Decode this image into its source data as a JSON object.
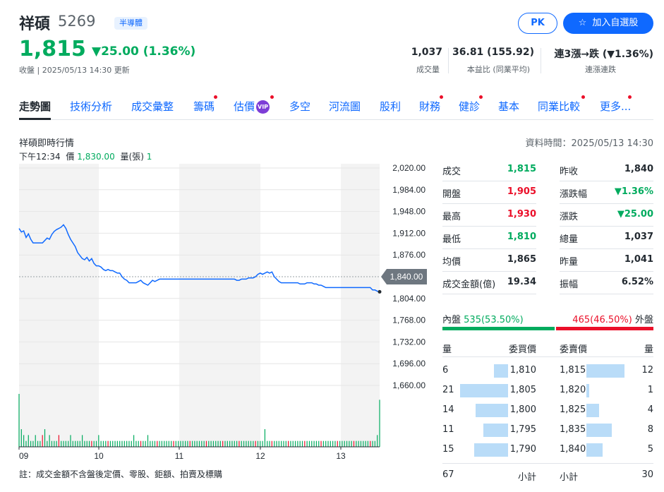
{
  "header": {
    "name": "祥碩",
    "code": "5269",
    "industry": "半導體",
    "pk_label": "PK",
    "watchlist_label": "加入自選股",
    "price": "1,815",
    "change": "▼25.00 (1.36%)",
    "close_time": "收盤 | 2025/05/13 14:30 更新",
    "stats": [
      {
        "value": "1,037",
        "label": "成交量"
      },
      {
        "value": "36.81 (155.92)",
        "label": "本益比 (同業平均)"
      },
      {
        "value": "連3漲→跌 (▼1.36%)",
        "label": "連漲連跌"
      }
    ]
  },
  "tabs": [
    {
      "label": "走勢圖",
      "active": true,
      "dot": false
    },
    {
      "label": "技術分析",
      "dot": false
    },
    {
      "label": "成交彙整",
      "dot": false
    },
    {
      "label": "籌碼",
      "dot": true
    },
    {
      "label": "估價",
      "dot": true,
      "vip": "VIP"
    },
    {
      "label": "多空",
      "dot": false
    },
    {
      "label": "河流圖",
      "dot": false
    },
    {
      "label": "股利",
      "dot": false
    },
    {
      "label": "財務",
      "dot": true
    },
    {
      "label": "健診",
      "dot": true
    },
    {
      "label": "基本",
      "dot": false
    },
    {
      "label": "同業比較",
      "dot": true
    },
    {
      "label": "更多...",
      "dot": true
    }
  ],
  "chart_section": {
    "title": "祥碩即時行情",
    "data_time": "資料時間：2025/05/13 14:30",
    "tooltip": {
      "time": "下午12:34",
      "price_label": "價",
      "price": "1,830.00",
      "vol_label": "量(張)",
      "vol": "1"
    },
    "current_tag": "1,840.00",
    "footnote": "註：成交金額不含盤後定價、零股、鉅額、拍賣及標購"
  },
  "chart_data": {
    "type": "line",
    "y_ticks": [
      "2,020.00",
      "1,984.00",
      "1,948.00",
      "1,912.00",
      "1,876.00",
      "1,840.00",
      "1,804.00",
      "1,768.00",
      "1,732.00",
      "1,696.00",
      "1,660.00"
    ],
    "x_ticks": [
      "09",
      "10",
      "11",
      "12",
      "13"
    ],
    "ylim": [
      1660,
      2020
    ],
    "reference_price": 1840,
    "series": [
      {
        "values": [
          1920,
          1914,
          1916,
          1905,
          1911,
          1902,
          1896,
          1896,
          1896,
          1896,
          1896,
          1900,
          1904,
          1902,
          1910,
          1915,
          1918,
          1920,
          1922,
          1926,
          1920,
          1910,
          1902,
          1896,
          1890,
          1880,
          1875,
          1870,
          1868,
          1872,
          1866,
          1870,
          1862,
          1858,
          1858,
          1856,
          1852,
          1850,
          1852,
          1850,
          1850,
          1848,
          1846,
          1846,
          1840,
          1836,
          1834,
          1830,
          1830,
          1830,
          1830,
          1832,
          1834,
          1830,
          1828,
          1826,
          1830,
          1834,
          1832,
          1834,
          1836,
          1836,
          1836,
          1836,
          1836,
          1836,
          1836,
          1836,
          1836,
          1836,
          1836,
          1836,
          1836,
          1836,
          1836,
          1836,
          1836,
          1836,
          1836,
          1836,
          1836,
          1836,
          1836,
          1836,
          1836,
          1836,
          1836,
          1836,
          1836,
          1836,
          1836,
          1836,
          1836,
          1834,
          1834,
          1836,
          1836,
          1836,
          1838,
          1838,
          1838,
          1840,
          1844,
          1846,
          1844,
          1846,
          1848,
          1846,
          1848,
          1840,
          1836,
          1832,
          1830,
          1830,
          1830,
          1830,
          1830,
          1830,
          1830,
          1830,
          1828,
          1828,
          1828,
          1830,
          1830,
          1830,
          1828,
          1828,
          1826,
          1826,
          1824,
          1822,
          1822,
          1822,
          1822,
          1822,
          1822,
          1822,
          1822,
          1822,
          1822,
          1822,
          1822,
          1822,
          1822,
          1822,
          1822,
          1822,
          1822,
          1822,
          1822,
          1818,
          1818,
          1816,
          1815
        ]
      }
    ],
    "volume": [
      9,
      3,
      2,
      1,
      2,
      1,
      1,
      2,
      1,
      1,
      2,
      3,
      1,
      2,
      1,
      1,
      1,
      2,
      1,
      1,
      1,
      1,
      2,
      1,
      1,
      1,
      1,
      2,
      1,
      1,
      1,
      1,
      1,
      1,
      2,
      1,
      1,
      1,
      1,
      1,
      1,
      1,
      1,
      1,
      1,
      1,
      1,
      1,
      1,
      2,
      1,
      1,
      1,
      1,
      1,
      2,
      1,
      1,
      1,
      1,
      1,
      1,
      1,
      1,
      1,
      1,
      1,
      1,
      1,
      1,
      1,
      1,
      1,
      1,
      1,
      1,
      1,
      1,
      1,
      1,
      1,
      1,
      1,
      1,
      1,
      1,
      1,
      1,
      1,
      1,
      1,
      1,
      1,
      1,
      1,
      1,
      1,
      1,
      1,
      1,
      1,
      1,
      1,
      1,
      1,
      3,
      1,
      1,
      1,
      1,
      1,
      1,
      1,
      1,
      1,
      1,
      1,
      1,
      1,
      1,
      1,
      1,
      1,
      1,
      1,
      1,
      1,
      1,
      1,
      1,
      1,
      1,
      1,
      1,
      1,
      1,
      1,
      1,
      1,
      1,
      1,
      1,
      1,
      1,
      1,
      1,
      1,
      1,
      1,
      1,
      1,
      1,
      1,
      2,
      8
    ]
  },
  "quote": {
    "left": [
      {
        "label": "成交",
        "value": "1,815",
        "color": "green"
      },
      {
        "label": "開盤",
        "value": "1,905",
        "color": "red"
      },
      {
        "label": "最高",
        "value": "1,930",
        "color": "red"
      },
      {
        "label": "最低",
        "value": "1,810",
        "color": "green"
      },
      {
        "label": "均價",
        "value": "1,865",
        "color": "dark"
      },
      {
        "label": "成交金額(億)",
        "value": "19.34",
        "color": "dark"
      }
    ],
    "right": [
      {
        "label": "昨收",
        "value": "1,840",
        "color": "dark"
      },
      {
        "label": "漲跌幅",
        "value": "▼1.36%",
        "color": "green"
      },
      {
        "label": "漲跌",
        "value": "▼25.00",
        "color": "green"
      },
      {
        "label": "總量",
        "value": "1,037",
        "color": "dark"
      },
      {
        "label": "昨量",
        "value": "1,041",
        "color": "dark"
      },
      {
        "label": "振幅",
        "value": "6.52%",
        "color": "dark"
      }
    ]
  },
  "orderbook": {
    "inner_label": "內盤",
    "inner_value": "535",
    "inner_pct": "(53.50%)",
    "outer_value": "465",
    "outer_pct": "(46.50%)",
    "outer_label": "外盤",
    "inner_ratio": 0.535,
    "head": {
      "qty": "量",
      "bid": "委買價",
      "ask": "委賣價",
      "qty2": "量"
    },
    "bids": [
      {
        "qty": "6",
        "price": "1,810",
        "ratio": 0.29
      },
      {
        "qty": "21",
        "price": "1,805",
        "ratio": 1.0
      },
      {
        "qty": "14",
        "price": "1,800",
        "ratio": 0.67
      },
      {
        "qty": "11",
        "price": "1,795",
        "ratio": 0.52
      },
      {
        "qty": "15",
        "price": "1,790",
        "ratio": 0.71
      }
    ],
    "asks": [
      {
        "price": "1,815",
        "qty": "12",
        "ratio": 1.0
      },
      {
        "price": "1,820",
        "qty": "1",
        "ratio": 0.08
      },
      {
        "price": "1,825",
        "qty": "4",
        "ratio": 0.33
      },
      {
        "price": "1,835",
        "qty": "8",
        "ratio": 0.67
      },
      {
        "price": "1,840",
        "qty": "5",
        "ratio": 0.42
      }
    ],
    "bid_total": "67",
    "bid_total_label": "小計",
    "ask_total_label": "小計",
    "ask_total": "30"
  },
  "colors": {
    "up": "#eb0f29",
    "down": "#00ab5e",
    "accent": "#0f69ff",
    "line": "#0f69ff"
  }
}
